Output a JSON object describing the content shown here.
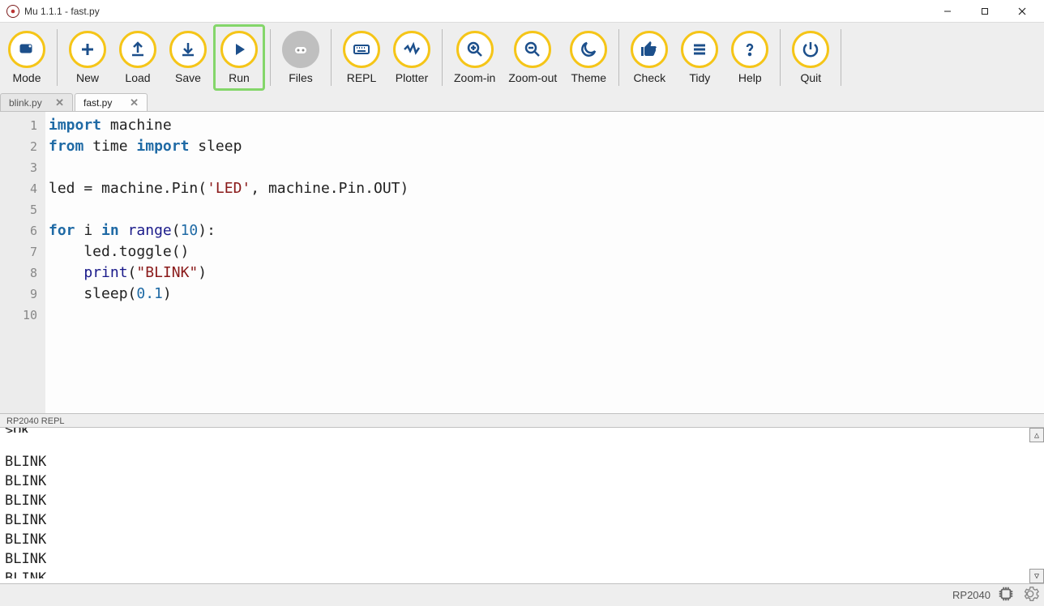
{
  "window": {
    "title": "Mu 1.1.1 - fast.py"
  },
  "toolbar": {
    "buttons": [
      {
        "id": "mode",
        "label": "Mode",
        "icon": "mode-icon"
      },
      {
        "id": "new",
        "label": "New",
        "icon": "plus-icon"
      },
      {
        "id": "load",
        "label": "Load",
        "icon": "load-icon"
      },
      {
        "id": "save",
        "label": "Save",
        "icon": "save-icon"
      },
      {
        "id": "run",
        "label": "Run",
        "icon": "play-icon",
        "highlight": true
      },
      {
        "id": "files",
        "label": "Files",
        "icon": "files-icon",
        "disabled": true
      },
      {
        "id": "repl",
        "label": "REPL",
        "icon": "keyboard-icon"
      },
      {
        "id": "plotter",
        "label": "Plotter",
        "icon": "plotter-icon"
      },
      {
        "id": "zoomin",
        "label": "Zoom-in",
        "icon": "zoom-in-icon"
      },
      {
        "id": "zoomout",
        "label": "Zoom-out",
        "icon": "zoom-out-icon"
      },
      {
        "id": "theme",
        "label": "Theme",
        "icon": "moon-icon"
      },
      {
        "id": "check",
        "label": "Check",
        "icon": "thumb-icon"
      },
      {
        "id": "tidy",
        "label": "Tidy",
        "icon": "tidy-icon"
      },
      {
        "id": "help",
        "label": "Help",
        "icon": "help-icon"
      },
      {
        "id": "quit",
        "label": "Quit",
        "icon": "power-icon"
      }
    ]
  },
  "tabs": [
    {
      "label": "blink.py",
      "active": false
    },
    {
      "label": "fast.py",
      "active": true
    }
  ],
  "code_lines": [
    {
      "n": 1,
      "tokens": [
        [
          "kw",
          "import"
        ],
        [
          "",
          " machine"
        ]
      ]
    },
    {
      "n": 2,
      "tokens": [
        [
          "kw",
          "from"
        ],
        [
          "",
          " time "
        ],
        [
          "kw",
          "import"
        ],
        [
          "",
          " sleep"
        ]
      ]
    },
    {
      "n": 3,
      "tokens": [
        [
          "",
          ""
        ]
      ]
    },
    {
      "n": 4,
      "tokens": [
        [
          "",
          "led = machine.Pin("
        ],
        [
          "str",
          "'LED'"
        ],
        [
          "",
          ", machine.Pin.OUT)"
        ]
      ]
    },
    {
      "n": 5,
      "tokens": [
        [
          "",
          ""
        ]
      ]
    },
    {
      "n": 6,
      "tokens": [
        [
          "kw",
          "for"
        ],
        [
          "",
          " i "
        ],
        [
          "kw",
          "in"
        ],
        [
          "",
          " "
        ],
        [
          "fn",
          "range"
        ],
        [
          "",
          "("
        ],
        [
          "num",
          "10"
        ],
        [
          "",
          "):"
        ]
      ]
    },
    {
      "n": 7,
      "tokens": [
        [
          "",
          "    led.toggle()"
        ]
      ]
    },
    {
      "n": 8,
      "tokens": [
        [
          "",
          "    "
        ],
        [
          "fn",
          "print"
        ],
        [
          "",
          "("
        ],
        [
          "str",
          "\"BLINK\""
        ],
        [
          "",
          ")"
        ]
      ]
    },
    {
      "n": 9,
      "tokens": [
        [
          "",
          "    sleep("
        ],
        [
          "num",
          "0.1"
        ],
        [
          "",
          ")"
        ]
      ]
    },
    {
      "n": 10,
      "tokens": [
        [
          "",
          ""
        ]
      ]
    }
  ],
  "repl": {
    "title": "RP2040 REPL",
    "top_partial": ">OK",
    "lines": [
      "",
      "BLINK",
      "BLINK",
      "BLINK",
      "BLINK",
      "BLINK",
      "BLINK"
    ],
    "bottom_partial": "BLINK"
  },
  "status": {
    "mode": "RP2040"
  }
}
